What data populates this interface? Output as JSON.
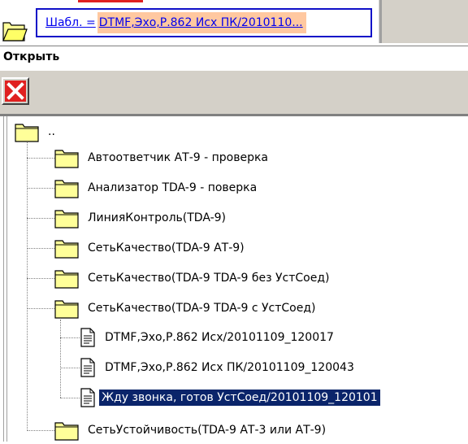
{
  "template": {
    "label": "Шабл. =",
    "value": "DTMF,Эхо,Р.862 Исх ПК/2010110..."
  },
  "panel": {
    "title": "Открыть"
  },
  "toolbar": {
    "close_icon": "close-icon",
    "close_color": "#e02020"
  },
  "tree": {
    "up_label": "..",
    "items": [
      {
        "label": "Автоответчик АТ-9 - проверка",
        "type": "folder"
      },
      {
        "label": "Анализатор TDA-9 - поверка",
        "type": "folder"
      },
      {
        "label": "ЛинияКонтроль(TDA-9)",
        "type": "folder"
      },
      {
        "label": "СетьКачество(TDA-9 АТ-9)",
        "type": "folder"
      },
      {
        "label": "СетьКачество(TDA-9 TDA-9 без УстСоед)",
        "type": "folder"
      },
      {
        "label": "СетьКачество(TDA-9 TDA-9 с УстСоед)",
        "type": "folder-open"
      },
      {
        "label": "DTMF,Эхо,Р.862 Исх/20101109_120017",
        "type": "file"
      },
      {
        "label": "DTMF,Эхо,Р.862 Исх ПК/20101109_120043",
        "type": "file"
      },
      {
        "label": "Жду звонка, готов УстСоед/20101109_120101",
        "type": "file",
        "selected": true
      },
      {
        "label": "СетьУстойчивость(TDA-9 АТ-3 или АТ-9)",
        "type": "folder"
      }
    ]
  },
  "colors": {
    "folder_fill": "#ffff99",
    "selection": "#0a246a",
    "link": "#0000ee",
    "template_highlight": "#ffc8a0"
  }
}
